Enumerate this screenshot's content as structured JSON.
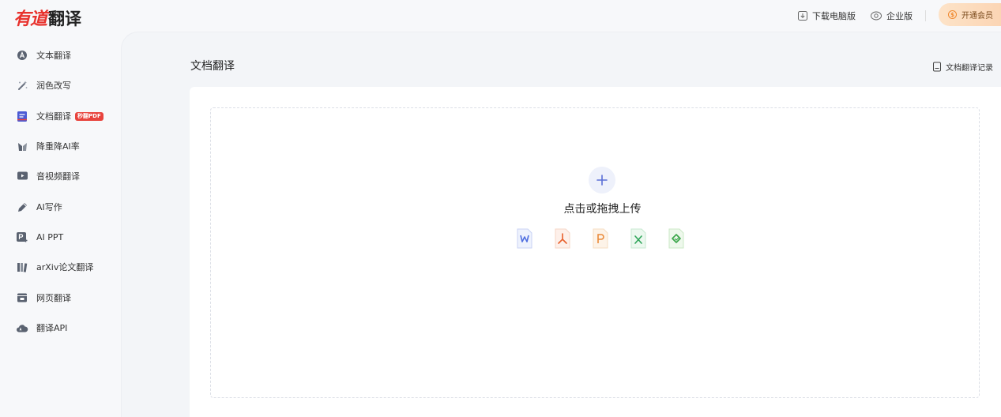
{
  "app": {
    "logo_red": "有道",
    "logo_black": "翻译"
  },
  "header": {
    "download_label": "下载电脑版",
    "enterprise_label": "企业版",
    "vip_label": "开通会员"
  },
  "sidebar": {
    "items": [
      {
        "label": "文本翻译",
        "icon": "text-translate-icon"
      },
      {
        "label": "润色改写",
        "icon": "magic-wand-icon"
      },
      {
        "label": "文档翻译",
        "icon": "document-icon",
        "badge": "秒翻PDF"
      },
      {
        "label": "降重降AI率",
        "icon": "reduce-icon"
      },
      {
        "label": "音视频翻译",
        "icon": "video-icon"
      },
      {
        "label": "AI写作",
        "icon": "pen-icon"
      },
      {
        "label": "AI PPT",
        "icon": "ppt-icon"
      },
      {
        "label": "arXiv论文翻译",
        "icon": "books-icon"
      },
      {
        "label": "网页翻译",
        "icon": "webpage-icon"
      },
      {
        "label": "翻译API",
        "icon": "api-cloud-icon"
      }
    ]
  },
  "main": {
    "title": "文档翻译",
    "history_label": "文档翻译记录",
    "upload_text": "点击或拖拽上传",
    "formats": [
      "word-file-icon",
      "pdf-file-icon",
      "ppt-file-icon",
      "excel-file-icon",
      "epub-file-icon"
    ]
  },
  "colors": {
    "brand": "#e8322d",
    "accent": "#5b6fd6",
    "background": "#f7f8fa"
  }
}
